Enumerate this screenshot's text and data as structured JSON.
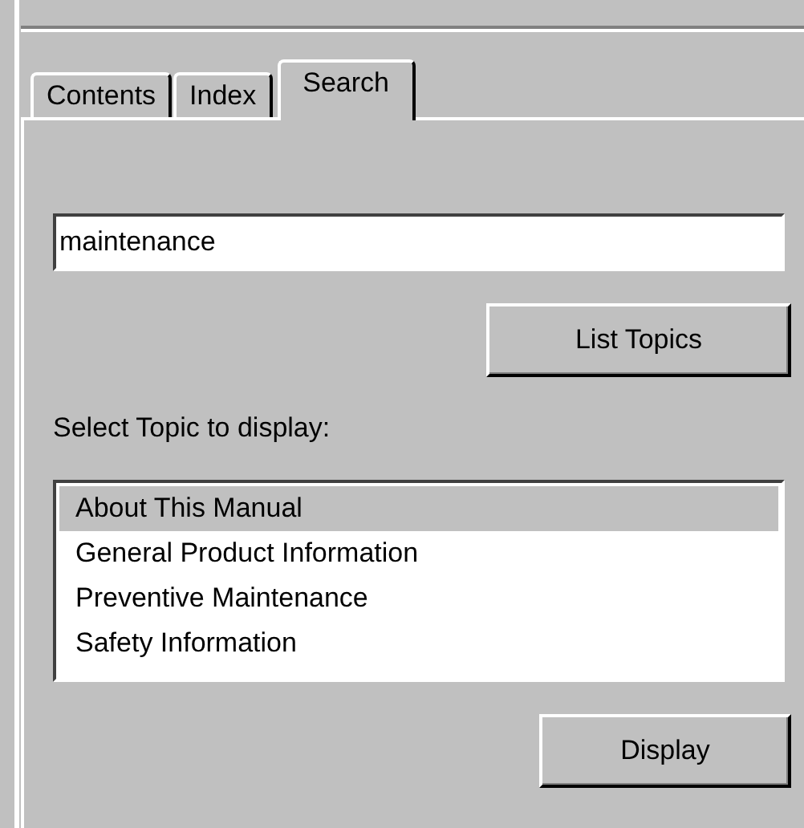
{
  "tabs": [
    {
      "label": "Contents",
      "selected": false
    },
    {
      "label": "Index",
      "selected": false
    },
    {
      "label": "Search",
      "selected": true
    }
  ],
  "search": {
    "value": "maintenance"
  },
  "list_button": {
    "label": "List Topics"
  },
  "topics_label": {
    "label": "Select Topic to display:"
  },
  "topics": [
    {
      "label": "About This Manual",
      "selected": true
    },
    {
      "label": "General Product Information",
      "selected": false
    },
    {
      "label": "Preventive Maintenance",
      "selected": false
    },
    {
      "label": "Safety Information",
      "selected": false
    }
  ],
  "display_button": {
    "label": "Display"
  }
}
